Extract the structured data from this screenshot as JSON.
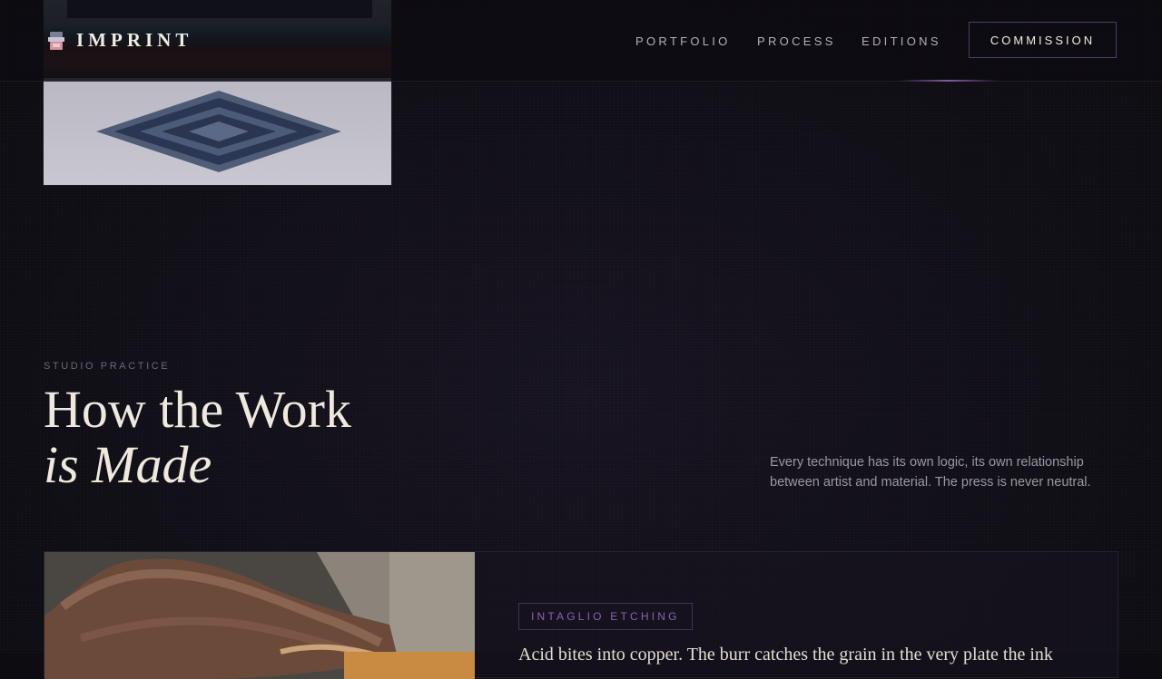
{
  "brand": {
    "name": "IMPRINT",
    "icon": "ink-press-icon"
  },
  "nav": {
    "links": [
      "PORTFOLIO",
      "PROCESS",
      "EDITIONS"
    ],
    "cta": "COMMISSION"
  },
  "section": {
    "eyebrow": "STUDIO PRACTICE",
    "title_line1": "How the Work",
    "title_line2": "is Made",
    "intro": "Every technique has its own logic, its own relationship between artist and material. The press is never neutral."
  },
  "technique_card": {
    "tag": "INTAGLIO ETCHING",
    "text_preview": "Acid bites into copper. The burr catches the grain in the very plate the ink"
  },
  "colors": {
    "accent": "#8a63b4",
    "background": "#100e16",
    "text": "#efe9dd"
  }
}
